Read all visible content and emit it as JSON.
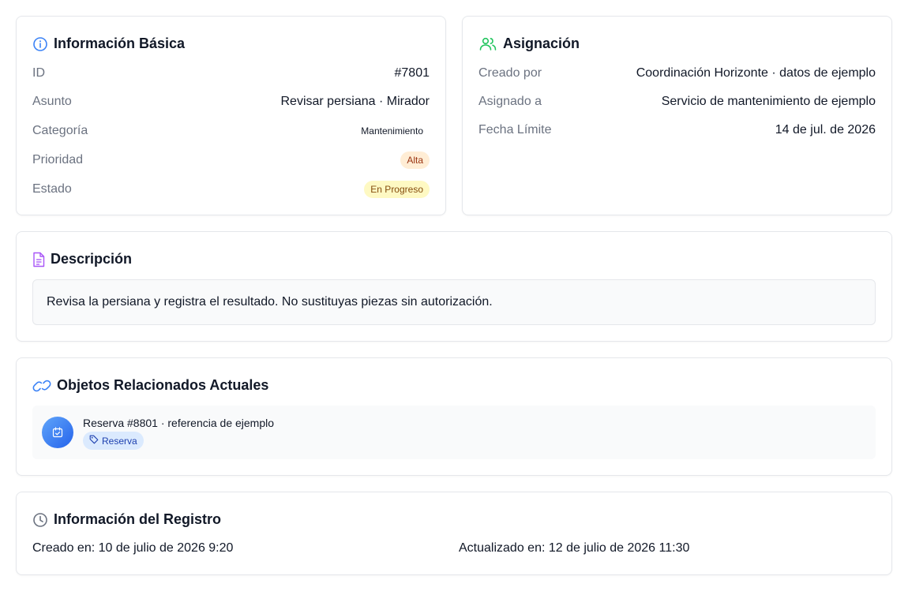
{
  "basic": {
    "title": "Información Básica",
    "id_label": "ID",
    "id_value": "#7801",
    "subject_label": "Asunto",
    "subject_value": "Revisar persiana · Mirador",
    "category_label": "Categoría",
    "category_value": "Mantenimiento",
    "priority_label": "Prioridad",
    "priority_value": "Alta",
    "status_label": "Estado",
    "status_value": "En Progreso"
  },
  "assignment": {
    "title": "Asignación",
    "created_by_label": "Creado por",
    "created_by_value": "Coordinación Horizonte · datos de ejemplo",
    "assigned_to_label": "Asignado a",
    "assigned_to_value": "Servicio de mantenimiento de ejemplo",
    "due_label": "Fecha Límite",
    "due_value": "14 de jul. de 2026"
  },
  "description": {
    "title": "Descripción",
    "text": "Revisa la persiana y registra el resultado. No sustituyas piezas sin autorización."
  },
  "related": {
    "title": "Objetos Relacionados Actuales",
    "items": [
      {
        "name": "Reserva #8801 · referencia de ejemplo",
        "tag": "Reserva"
      }
    ]
  },
  "record": {
    "title": "Información del Registro",
    "created": "Creado en: 10 de julio de 2026 9:20",
    "updated": "Actualizado en: 12 de julio de 2026 11:30"
  },
  "colors": {
    "info_icon": "#3b82f6",
    "assign_icon": "#22c55e",
    "desc_icon": "#a855f7",
    "link_icon": "#3b82f6",
    "clock_icon": "#6b7280"
  },
  "icons": {
    "basic": "info-icon",
    "assignment": "users-icon",
    "description": "file-text-icon",
    "related": "link-icon",
    "related_item": "calendar-check-icon",
    "tag": "tag-icon",
    "record": "clock-icon"
  }
}
